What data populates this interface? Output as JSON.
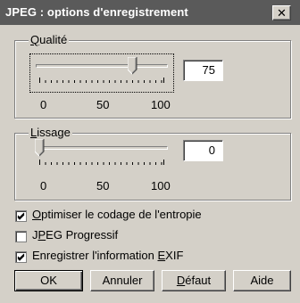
{
  "window": {
    "title": "JPEG : options d'enregistrement",
    "close_icon": "close-icon"
  },
  "quality": {
    "label": "Qualité",
    "underline_char": "Q",
    "label_rest": "ualité",
    "value": "75",
    "slider_min": 0,
    "slider_max": 100,
    "slider_value": 75,
    "scale_labels": [
      "0",
      "50",
      "100"
    ]
  },
  "smoothing": {
    "label": "Lissage",
    "underline_char": "L",
    "label_rest": "issage",
    "value": "0",
    "slider_min": 0,
    "slider_max": 100,
    "slider_value": 0,
    "scale_labels": [
      "0",
      "50",
      "100"
    ]
  },
  "options": [
    {
      "label": "Optimiser le codage de l'entropie",
      "checked": true
    },
    {
      "label": "JPEG Progressif",
      "checked": false
    },
    {
      "label": "Enregistrer l'information EXIF",
      "checked": true
    }
  ],
  "buttons": {
    "ok": "OK",
    "cancel": "Annuler",
    "default": "Défaut",
    "help": "Aide"
  }
}
